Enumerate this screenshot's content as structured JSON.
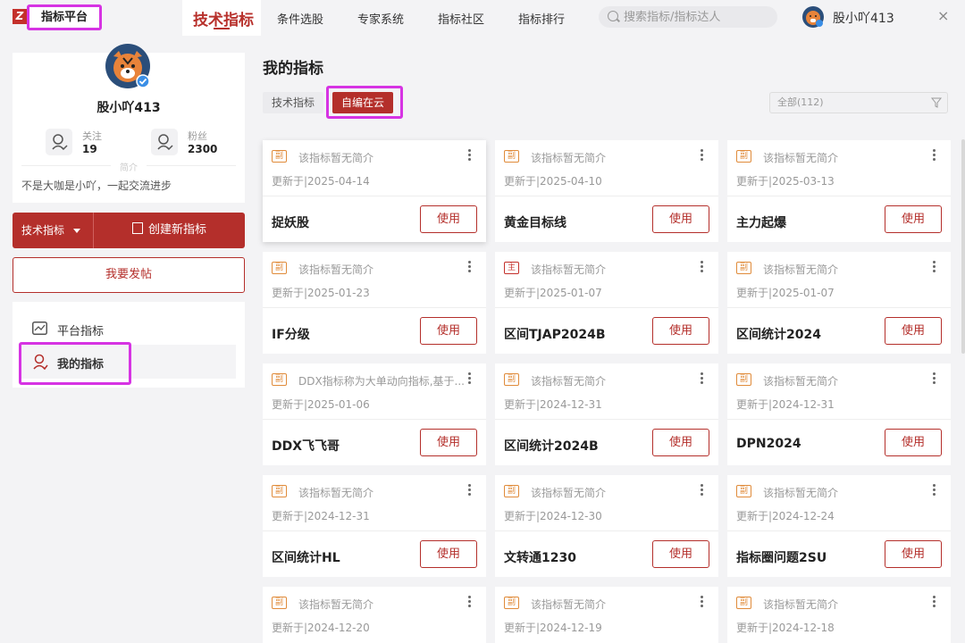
{
  "topbar": {
    "logo": "Z",
    "platform_title": "指标平台",
    "nav": [
      "技术指标",
      "条件选股",
      "专家系统",
      "指标社区",
      "指标排行"
    ],
    "search_placeholder": "搜索指标/指标达人",
    "username": "股小吖413",
    "close": "×"
  },
  "profile": {
    "name": "股小吖413",
    "follow_label": "关注",
    "follow_count": "19",
    "fans_label": "粉丝",
    "fans_count": "2300",
    "intro_label": "简介",
    "intro": "不是大咖是小吖，一起交流进步"
  },
  "actions": {
    "dropdown_label": "技术指标",
    "create_label": "创建新指标",
    "post_label": "我要发帖"
  },
  "side_menu": {
    "items": [
      {
        "label": "平台指标",
        "icon": "chart-line-icon"
      },
      {
        "label": "我的指标",
        "icon": "user-icon"
      }
    ]
  },
  "main": {
    "title": "我的指标",
    "tabs": [
      "技术指标",
      "自编在云"
    ],
    "filter": "全部(112)"
  },
  "cards": [
    {
      "tag": "副",
      "desc": "该指标暂无简介",
      "updated": "更新于|2025-04-14",
      "name": "捉妖股",
      "use": "使用"
    },
    {
      "tag": "副",
      "desc": "该指标暂无简介",
      "updated": "更新于|2025-04-10",
      "name": "黄金目标线",
      "use": "使用"
    },
    {
      "tag": "副",
      "desc": "该指标暂无简介",
      "updated": "更新于|2025-03-13",
      "name": "主力起爆",
      "use": "使用"
    },
    {
      "tag": "副",
      "desc": "该指标暂无简介",
      "updated": "更新于|2025-01-23",
      "name": "IF分级",
      "use": "使用"
    },
    {
      "tag": "主",
      "desc": "该指标暂无简介",
      "updated": "更新于|2025-01-07",
      "name": "区间TJAP2024B",
      "use": "使用"
    },
    {
      "tag": "副",
      "desc": "该指标暂无简介",
      "updated": "更新于|2025-01-07",
      "name": "区间统计2024",
      "use": "使用"
    },
    {
      "tag": "副",
      "desc": "DDX指标称为大单动向指标,基于...",
      "updated": "更新于|2025-01-06",
      "name": "DDX飞飞哥",
      "use": "使用"
    },
    {
      "tag": "副",
      "desc": "该指标暂无简介",
      "updated": "更新于|2024-12-31",
      "name": "区间统计2024B",
      "use": "使用"
    },
    {
      "tag": "副",
      "desc": "该指标暂无简介",
      "updated": "更新于|2024-12-31",
      "name": "DPN2024",
      "use": "使用"
    },
    {
      "tag": "副",
      "desc": "该指标暂无简介",
      "updated": "更新于|2024-12-31",
      "name": "区间统计HL",
      "use": "使用"
    },
    {
      "tag": "副",
      "desc": "该指标暂无简介",
      "updated": "更新于|2024-12-30",
      "name": "文转通1230",
      "use": "使用"
    },
    {
      "tag": "副",
      "desc": "该指标暂无简介",
      "updated": "更新于|2024-12-24",
      "name": "指标圈问题2SU",
      "use": "使用"
    },
    {
      "tag": "副",
      "desc": "该指标暂无简介",
      "updated": "更新于|2024-12-20",
      "name": "",
      "use": ""
    },
    {
      "tag": "副",
      "desc": "该指标暂无简介",
      "updated": "更新于|2024-12-19",
      "name": "",
      "use": ""
    },
    {
      "tag": "副",
      "desc": "该指标暂无简介",
      "updated": "更新于|2024-12-18",
      "name": "",
      "use": ""
    }
  ],
  "colors": {
    "accent": "#b42f2b",
    "highlight": "#d633e3",
    "tag_orange": "#e08b3a"
  }
}
